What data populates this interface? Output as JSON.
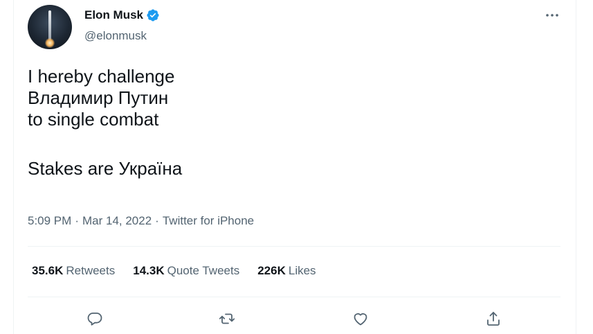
{
  "author": {
    "display_name": "Elon Musk",
    "handle": "@elonmusk",
    "verified": true,
    "avatar_icon": "rocket-launch-avatar"
  },
  "tweet": {
    "lines": [
      "I hereby challenge",
      "Владимир Путин",
      "to single combat",
      "Stakes are Україна"
    ]
  },
  "meta": {
    "time": "5:09 PM",
    "separator": "·",
    "date": "Mar 14, 2022",
    "source": "Twitter for iPhone"
  },
  "stats": {
    "retweets": {
      "count": "35.6K",
      "label": "Retweets"
    },
    "quote_tweets": {
      "count": "14.3K",
      "label": "Quote Tweets"
    },
    "likes": {
      "count": "226K",
      "label": "Likes"
    }
  },
  "actions": [
    "reply-icon",
    "retweet-icon",
    "like-icon",
    "share-icon"
  ],
  "colors": {
    "text": "#0f1419",
    "secondary": "#536471",
    "verified": "#1d9bf0",
    "divider": "#eff3f4"
  }
}
